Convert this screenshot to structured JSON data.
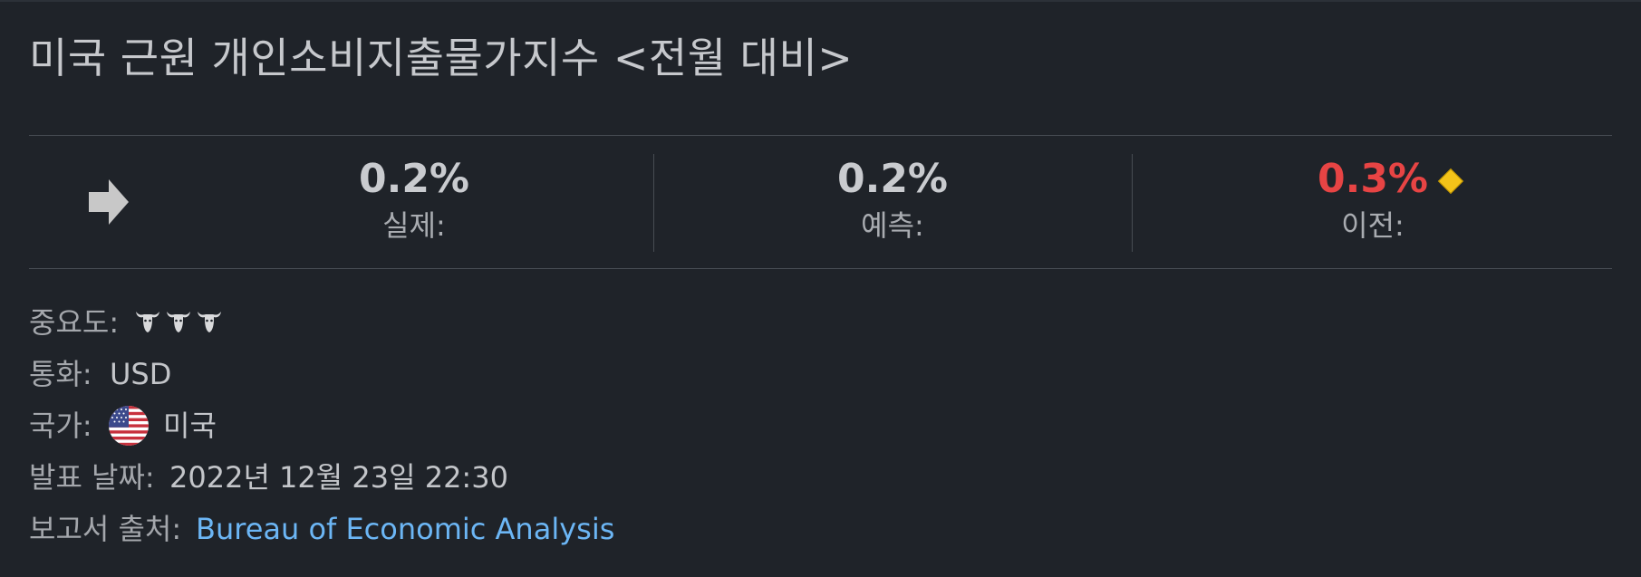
{
  "header": {
    "title": "미국 근원 개인소비지출물가지수 <전월 대비>"
  },
  "trend": {
    "icon": "arrow-right-icon",
    "color": "#c8c8c8"
  },
  "stats": {
    "actual": {
      "value": "0.2%",
      "label": "실제:"
    },
    "forecast": {
      "value": "0.2%",
      "label": "예측:"
    },
    "previous": {
      "value": "0.3%",
      "label": "이전:",
      "value_color": "#e74444",
      "revision_icon": "revision-diamond-icon",
      "revision_color": "#f3c319"
    }
  },
  "details": {
    "importance": {
      "label": "중요도:",
      "icon": "bull-icon",
      "level": 3,
      "max_level": 3
    },
    "currency": {
      "label": "통화:",
      "value": "USD"
    },
    "country": {
      "label": "국가:",
      "flag_icon": "us-flag-icon",
      "value": "미국"
    },
    "release_date": {
      "label": "발표 날짜:",
      "value": "2022년 12월 23일 22:30"
    },
    "source": {
      "label": "보고서 출처:",
      "value": "Bureau of Economic Analysis",
      "link_color": "#6cb6f5"
    }
  },
  "colors": {
    "background": "#1f2329",
    "divider": "#474c53"
  }
}
